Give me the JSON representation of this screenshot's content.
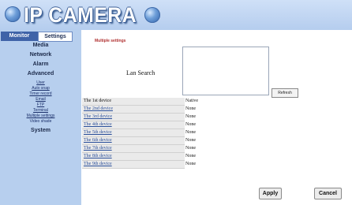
{
  "header": {
    "brand": "IP CAMERA"
  },
  "sidebar": {
    "tabs": {
      "monitor": "Monitor",
      "settings": "Settings"
    },
    "items": {
      "media": "Media",
      "network": "Network",
      "alarm": "Alarm",
      "advanced": "Advanced",
      "system": "System"
    },
    "advanced_sub": [
      "User",
      "Auto snap",
      "Timer record",
      "Email",
      "FTP",
      "Terminal",
      "Multiple settings",
      "Video shade"
    ]
  },
  "main": {
    "title": "Multiple settings",
    "lan_search_label": "Lan Search",
    "refresh_button": "Refresh",
    "devices": [
      {
        "name": "The 1st device",
        "status": "Native"
      },
      {
        "name": "The 2nd device",
        "status": "None"
      },
      {
        "name": "The 3rd device",
        "status": "None"
      },
      {
        "name": "The 4th device",
        "status": "None"
      },
      {
        "name": "The 5th device",
        "status": "None"
      },
      {
        "name": "The 6th device",
        "status": "None"
      },
      {
        "name": "The 7th device",
        "status": "None"
      },
      {
        "name": "The 8th device",
        "status": "None"
      },
      {
        "name": "The 9th device",
        "status": "None"
      }
    ],
    "apply_button": "Apply",
    "cancel_button": "Cancel"
  },
  "colors": {
    "header_bg": "#c2d7f3",
    "sidebar_bg": "#b7cfee",
    "tab_active": "#3f63a8",
    "title_red": "#b03030"
  }
}
